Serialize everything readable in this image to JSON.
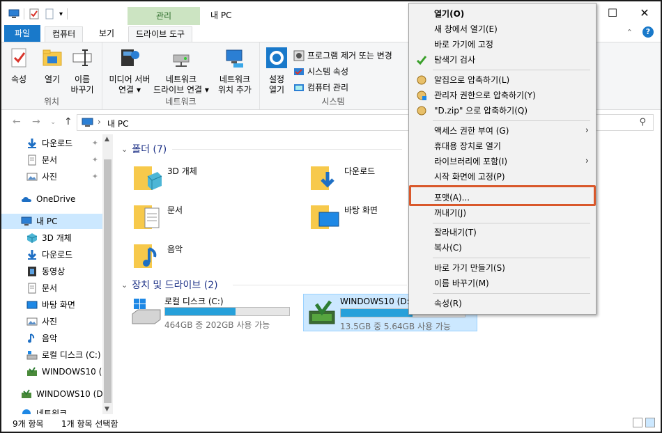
{
  "titlebar": {
    "manage_tab": "관리",
    "title": "내 PC",
    "minimize": "—",
    "maximize": "☐",
    "close": "✕"
  },
  "tabs": {
    "file": "파일",
    "computer": "컴퓨터",
    "view": "보기",
    "drive_tools": "드라이브 도구"
  },
  "ribbon": {
    "location_group": "위치",
    "network_group": "네트워크",
    "system_group": "시스템",
    "properties": "속성",
    "open": "열기",
    "rename_1": "이름",
    "rename_2": "바꾸기",
    "media_server_1": "미디어 서버",
    "media_server_2": "연결",
    "map_drive_1": "네트워크",
    "map_drive_2": "드라이브 연결",
    "add_location_1": "네트워크",
    "add_location_2": "위치 추가",
    "open_settings_1": "설정",
    "open_settings_2": "열기",
    "uninstall": "프로그램 제거 또는 변경",
    "system_props": "시스템 속성",
    "manage": "컴퓨터 관리",
    "dropdown": "▾"
  },
  "address": {
    "location": "내 PC",
    "search_glyph": "⚲"
  },
  "nav": {
    "items": [
      {
        "label": "다운로드",
        "pinned": true
      },
      {
        "label": "문서",
        "pinned": true
      },
      {
        "label": "사진",
        "pinned": true
      },
      {
        "label": "OneDrive"
      },
      {
        "label": "내 PC"
      },
      {
        "label": "3D 개체"
      },
      {
        "label": "다운로드"
      },
      {
        "label": "동영상"
      },
      {
        "label": "문서"
      },
      {
        "label": "바탕 화면"
      },
      {
        "label": "사진"
      },
      {
        "label": "음악"
      },
      {
        "label": "로컬 디스크 (C:)"
      },
      {
        "label": "WINDOWS10 (D:)"
      },
      {
        "label": "WINDOWS10 (D:)"
      },
      {
        "label": "네트워크"
      }
    ],
    "pin_glyph": "📌"
  },
  "content": {
    "folders_header": "폴더 (7)",
    "drives_header": "장치 및 드라이브 (2)",
    "folders": [
      {
        "label": "3D 개체"
      },
      {
        "label": "다운로드"
      },
      {
        "label": "문서"
      },
      {
        "label": "바탕 화면"
      },
      {
        "label": "음악"
      }
    ],
    "drives": [
      {
        "name": "로컬 디스크 (C:)",
        "sub": "464GB 중 202GB 사용 가능",
        "used_fraction": 0.565
      },
      {
        "name": "WINDOWS10 (D:)",
        "sub": "13.5GB 중 5.64GB 사용 가능",
        "used_fraction": 0.58
      }
    ]
  },
  "status": {
    "count": "9개 항목",
    "selected": "1개 항목 선택함"
  },
  "context_menu": {
    "items": [
      "열기(O)",
      "새 창에서 열기(E)",
      "바로 가기에 고정",
      "탐색기 검사",
      "알집으로 압축하기(L)",
      "관리자 권한으로 압축하기(Y)",
      "\"D.zip\" 으로 압축하기(Q)",
      "액세스 권한 부여 (G)",
      "휴대용 장치로 열기",
      "라이브러리에 포함(I)",
      "시작 화면에 고정(P)",
      "포맷(A)...",
      "꺼내기(J)",
      "잘라내기(T)",
      "복사(C)",
      "바로 가기 만들기(S)",
      "이름 바꾸기(M)",
      "속성(R)"
    ],
    "submenu_arrow": "›"
  },
  "colors": {
    "accent": "#1979ca",
    "highlight_border": "#d9582b",
    "selection": "#cce8ff",
    "drive_bar": "#26a0da"
  }
}
